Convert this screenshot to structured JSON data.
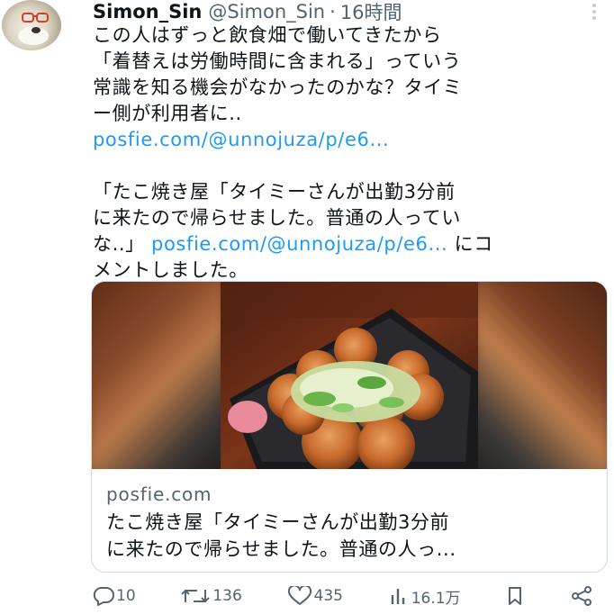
{
  "header": {
    "display_name": "Simon_Sin",
    "handle": "@Simon_Sin",
    "separator": "·",
    "time": "16時間"
  },
  "body": {
    "para1": [
      "この人はずっと飲食畑で働いてきたから",
      "「着替えは労働時間に含まれる」っていう",
      "常識を知る機会がなかったのかな？タイミ",
      "ー側が利用者に.."
    ],
    "link1": "posfie.com/@unnojuza/p/e6...",
    "para2_lines": [
      "「たこ焼き屋「タイミーさんが出勤3分前",
      "に来たので帰らせました。普通の人ってい"
    ],
    "para2_line3_pre": "な..」",
    "link2": "posfie.com/@unnojuza/p/e6...",
    "para2_line3_post": " にコ",
    "para2_line4": "メントしました。"
  },
  "card": {
    "domain": "posfie.com",
    "title_lines": [
      "たこ焼き屋「タイミーさんが出勤3分前",
      "に来たので帰らせました。普通の人っ..."
    ]
  },
  "actions": {
    "replies": "10",
    "reposts": "136",
    "likes": "435",
    "views": "16.1万"
  },
  "icons": [
    "more-icon",
    "reply-icon",
    "repost-icon",
    "like-icon",
    "views-icon",
    "bookmark-icon",
    "share-icon"
  ]
}
